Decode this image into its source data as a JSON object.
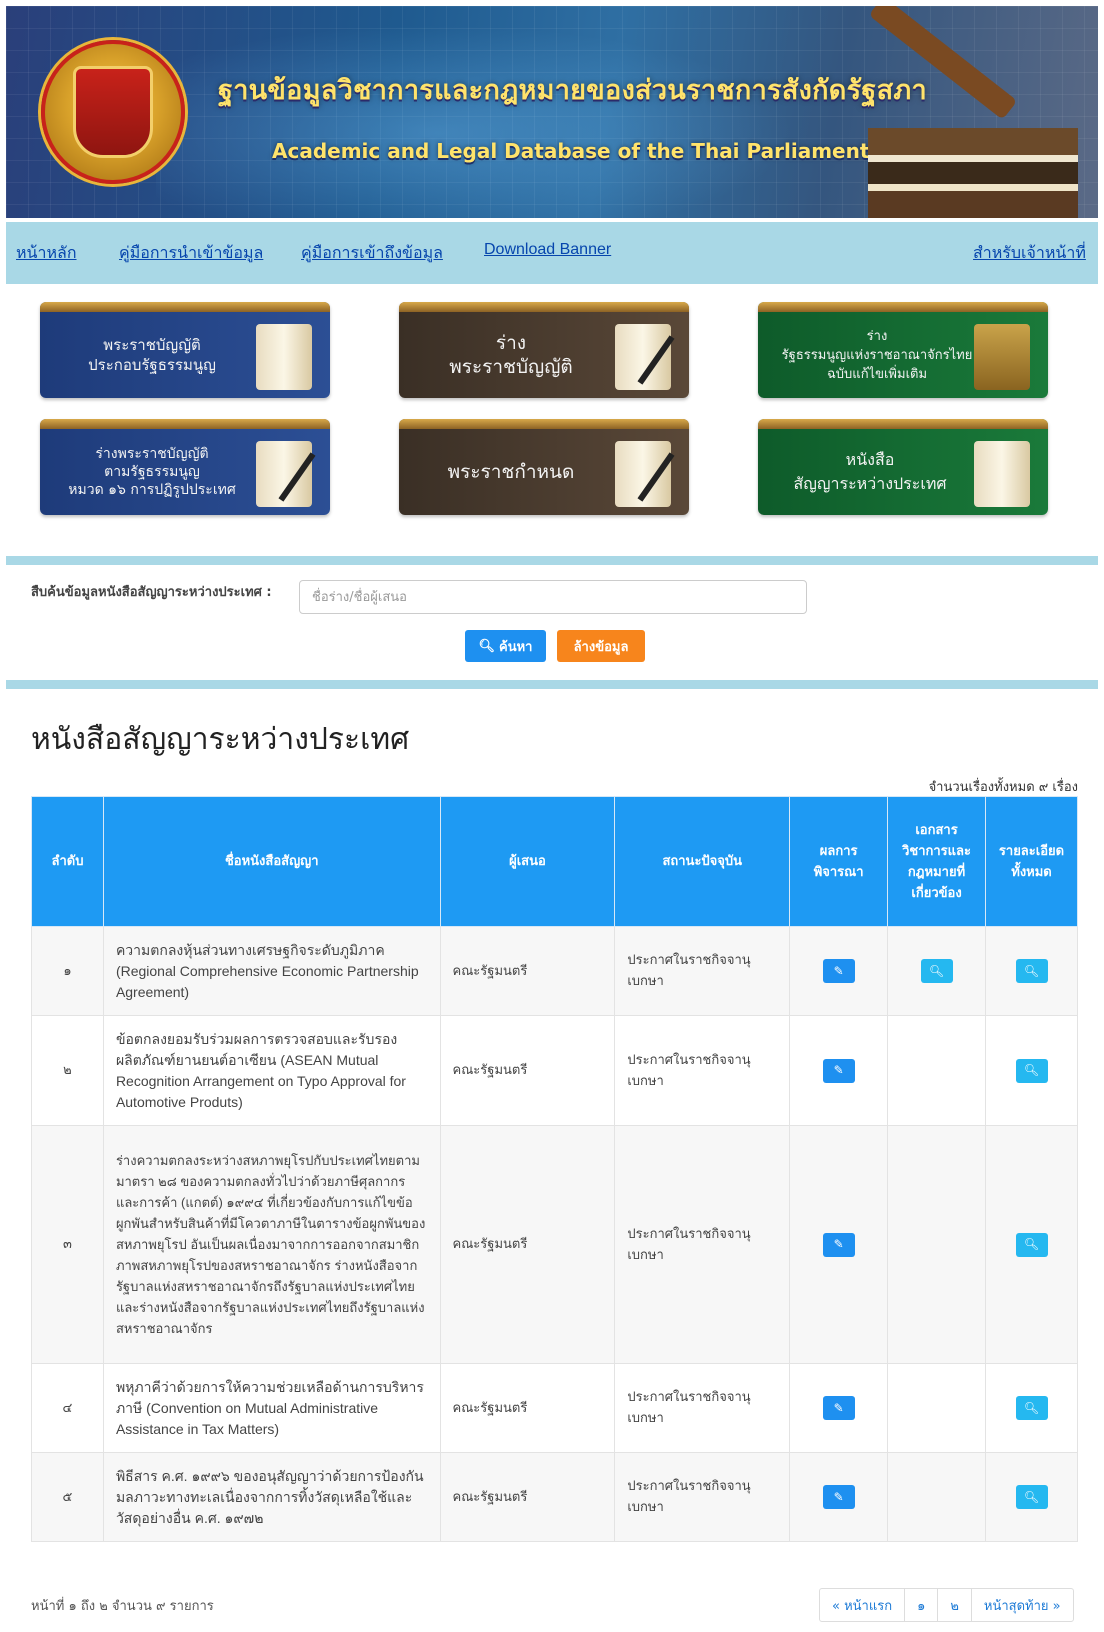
{
  "banner": {
    "title_th": "ฐานข้อมูลวิชาการและกฎหมายของส่วนราชการสังกัดรัฐสภา",
    "title_en": "Academic and Legal Database of the Thai Parliament"
  },
  "nav": {
    "home": "หน้าหลัก",
    "import_guide": "คู่มือการนำเข้าข้อมูล",
    "access_guide": "คู่มือการเข้าถึงข้อมูล",
    "download_banner": "Download Banner",
    "staff": "สำหรับเจ้าหน้าที่"
  },
  "tiles": [
    {
      "label": "พระราชบัญญัติ\nประกอบรัฐธรรมนูญ",
      "color": "blue"
    },
    {
      "label": "ร่าง\nพระราชบัญญัติ",
      "color": "brown"
    },
    {
      "label": "ร่าง\nรัฐธรรมนูญแห่งราชอาณาจักรไทย\nฉบับแก้ไขเพิ่มเติม",
      "color": "green"
    },
    {
      "label": "ร่างพระราชบัญญัติ\nตามรัฐธรรมนูญ\nหมวด ๑๖ การปฏิรูปประเทศ",
      "color": "blue"
    },
    {
      "label": "พระราชกำหนด",
      "color": "brown"
    },
    {
      "label": "หนังสือ\nสัญญาระหว่างประเทศ",
      "color": "green"
    }
  ],
  "search": {
    "label": "สืบค้นข้อมูลหนังสือสัญญาระหว่างประเทศ :",
    "placeholder": "ชื่อร่าง/ชื่อผู้เสนอ",
    "search_button": "ค้นหา",
    "clear_button": "ล้างข้อมูล"
  },
  "section": {
    "title": "หนังสือสัญญาระหว่างประเทศ",
    "total_text": "จำนวนเรื่องทั้งหมด ๙ เรื่อง"
  },
  "table": {
    "headers": [
      "ลำดับ",
      "ชื่อหนังสือสัญญา",
      "ผู้เสนอ",
      "สถานะปัจจุบัน",
      "ผลการพิจารณา",
      "เอกสารวิชาการและกฎหมายที่เกี่ยวข้อง",
      "รายละเอียดทั้งหมด"
    ],
    "rows": [
      {
        "no": "๑",
        "name": "ความตกลงหุ้นส่วนทางเศรษฐกิจระดับภูมิภาค (Regional Comprehensive Economic Partnership Agreement)",
        "proposer": "คณะรัฐมนตรี",
        "status": "ประกาศในราชกิจจานุเบกษา",
        "has_docs": true
      },
      {
        "no": "๒",
        "name": "ข้อตกลงยอมรับร่วมผลการตรวจสอบและรับรองผลิตภัณฑ์ยานยนต์อาเซียน (ASEAN Mutual Recognition Arrangement on Typo Approval for Automotive Produts)",
        "proposer": "คณะรัฐมนตรี",
        "status": "ประกาศในราชกิจจานุเบกษา",
        "has_docs": false
      },
      {
        "no": "๓",
        "name": "ร่างความตกลงระหว่างสหภาพยุโรปกับประเทศไทยตามมาตรา ๒๘ ของความตกลงทั่วไปว่าด้วยภาษีศุลกากรและการค้า (แกตต์) ๑๙๙๔ ที่เกี่ยวข้องกับการแก้ไขข้อผูกพันสำหรับสินค้าที่มีโควตาภาษีในตารางข้อผูกพันของสหภาพยุโรป อันเป็นผลเนื่องมาจากการออกจากสมาชิกภาพสหภาพยุโรปของสหราชอาณาจักร ร่างหนังสือจากรัฐบาลแห่งสหราชอาณาจักรถึงรัฐบาลแห่งประเทศไทย และร่างหนังสือจากรัฐบาลแห่งประเทศไทยถึงรัฐบาลแห่งสหราชอาณาจักร",
        "proposer": "คณะรัฐมนตรี",
        "status": "ประกาศในราชกิจจานุเบกษา",
        "has_docs": false
      },
      {
        "no": "๔",
        "name": "พหุภาคีว่าด้วยการให้ความช่วยเหลือด้านการบริหารภาษี (Convention on Mutual Administrative Assistance in Tax Matters)",
        "proposer": "คณะรัฐมนตรี",
        "status": "ประกาศในราชกิจจานุเบกษา",
        "has_docs": false
      },
      {
        "no": "๕",
        "name": "พิธีสาร ค.ศ. ๑๙๙๖ ของอนุสัญญาว่าด้วยการป้องกันมลภาวะทางทะเลเนื่องจากการทิ้งวัสดุเหลือใช้และวัสดุอย่างอื่น ค.ศ. ๑๙๗๒",
        "proposer": "คณะรัฐมนตรี",
        "status": "ประกาศในราชกิจจานุเบกษา",
        "has_docs": false
      }
    ]
  },
  "footer": {
    "summary": "หน้าที่ ๑ ถึง ๒ จำนวน ๙ รายการ",
    "pager": [
      "« หน้าแรก",
      "๑",
      "๒",
      "หน้าสุดท้าย »"
    ]
  },
  "colors": {
    "nav_bg": "#a9d8e6",
    "header_blue": "#1e9af3",
    "search_btn": "#1e90f0",
    "clear_btn": "#f7851c"
  }
}
